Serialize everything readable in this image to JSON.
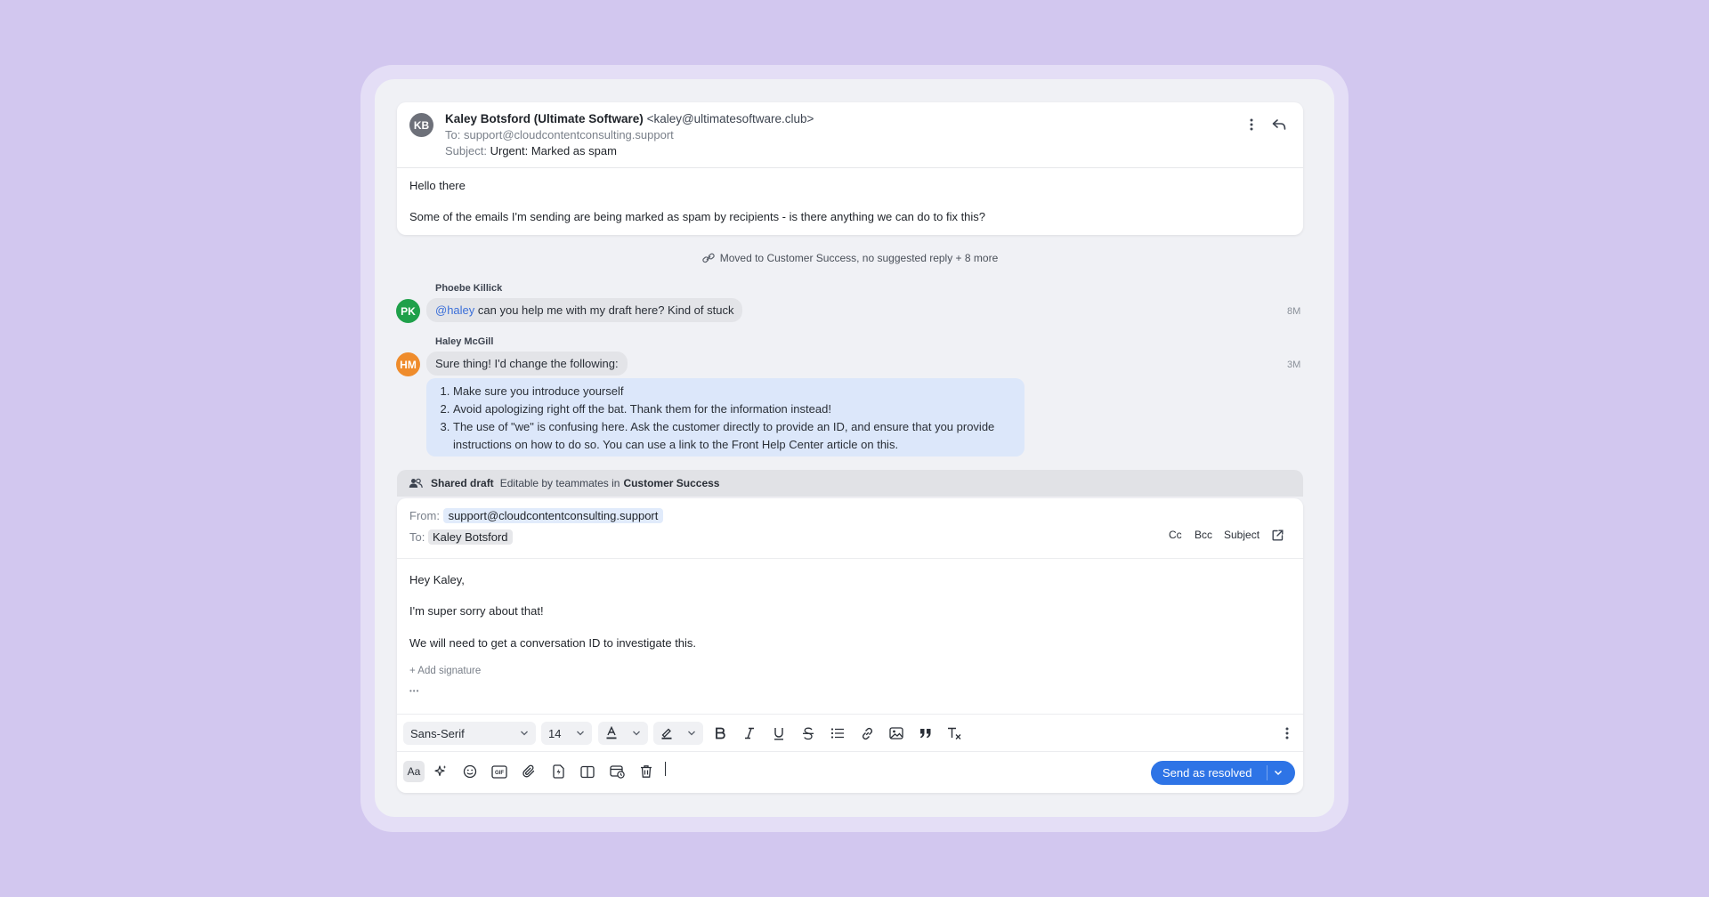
{
  "thread": {
    "message": {
      "avatar_initials": "KB",
      "sender_name": "Kaley Botsford (Ultimate Software)",
      "sender_email": "<kaley@ultimatesoftware.club>",
      "to_label": "To:",
      "to_value": "support@cloudcontentconsulting.support",
      "subject_label": "Subject:",
      "subject_value": "Urgent: Marked as spam",
      "body_greeting": "Hello there",
      "body_text": "Some of the emails I'm sending are being marked as spam by recipients - is there anything we can do to fix this?"
    },
    "activity_text": "Moved to Customer Success, no suggested reply + 8 more",
    "comments": [
      {
        "author": "Phoebe Killick",
        "initials": "PK",
        "avatar_color": "#1fa04a",
        "mention": "@haley",
        "text": " can you help me with my draft here? Kind of stuck",
        "time": "8M"
      },
      {
        "author": "Haley McGill",
        "initials": "HM",
        "avatar_color": "#ef8c2c",
        "text": "Sure thing! I'd change the following:",
        "time": "3M",
        "list": [
          "Make sure you introduce yourself",
          "Avoid apologizing right off the bat. Thank them for the information instead!",
          "The use of \"we\" is confusing here. Ask the customer directly to provide an ID, and ensure that you provide",
          "instructions on how to do so. You can use a link to the Front Help Center article on this."
        ]
      }
    ]
  },
  "shared_draft": {
    "label": "Shared draft",
    "editable_text": "Editable by teammates in",
    "team": "Customer Success"
  },
  "draft": {
    "from_label": "From:",
    "from_value": "support@cloudcontentconsulting.support",
    "to_label": "To:",
    "to_value": "Kaley Botsford",
    "cc": "Cc",
    "bcc": "Bcc",
    "subject": "Subject",
    "body": [
      "Hey Kaley,",
      "I'm super sorry about that!",
      "We will need to get a conversation ID to investigate this."
    ],
    "add_signature": "Add signature",
    "ellipsis": "•••",
    "font_family": "Sans-Serif",
    "font_size": "14",
    "send_label": "Send as resolved"
  },
  "colors": {
    "accent": "#2e74e6",
    "background": "#d2c7ef",
    "mention": "#3b6fd9"
  }
}
